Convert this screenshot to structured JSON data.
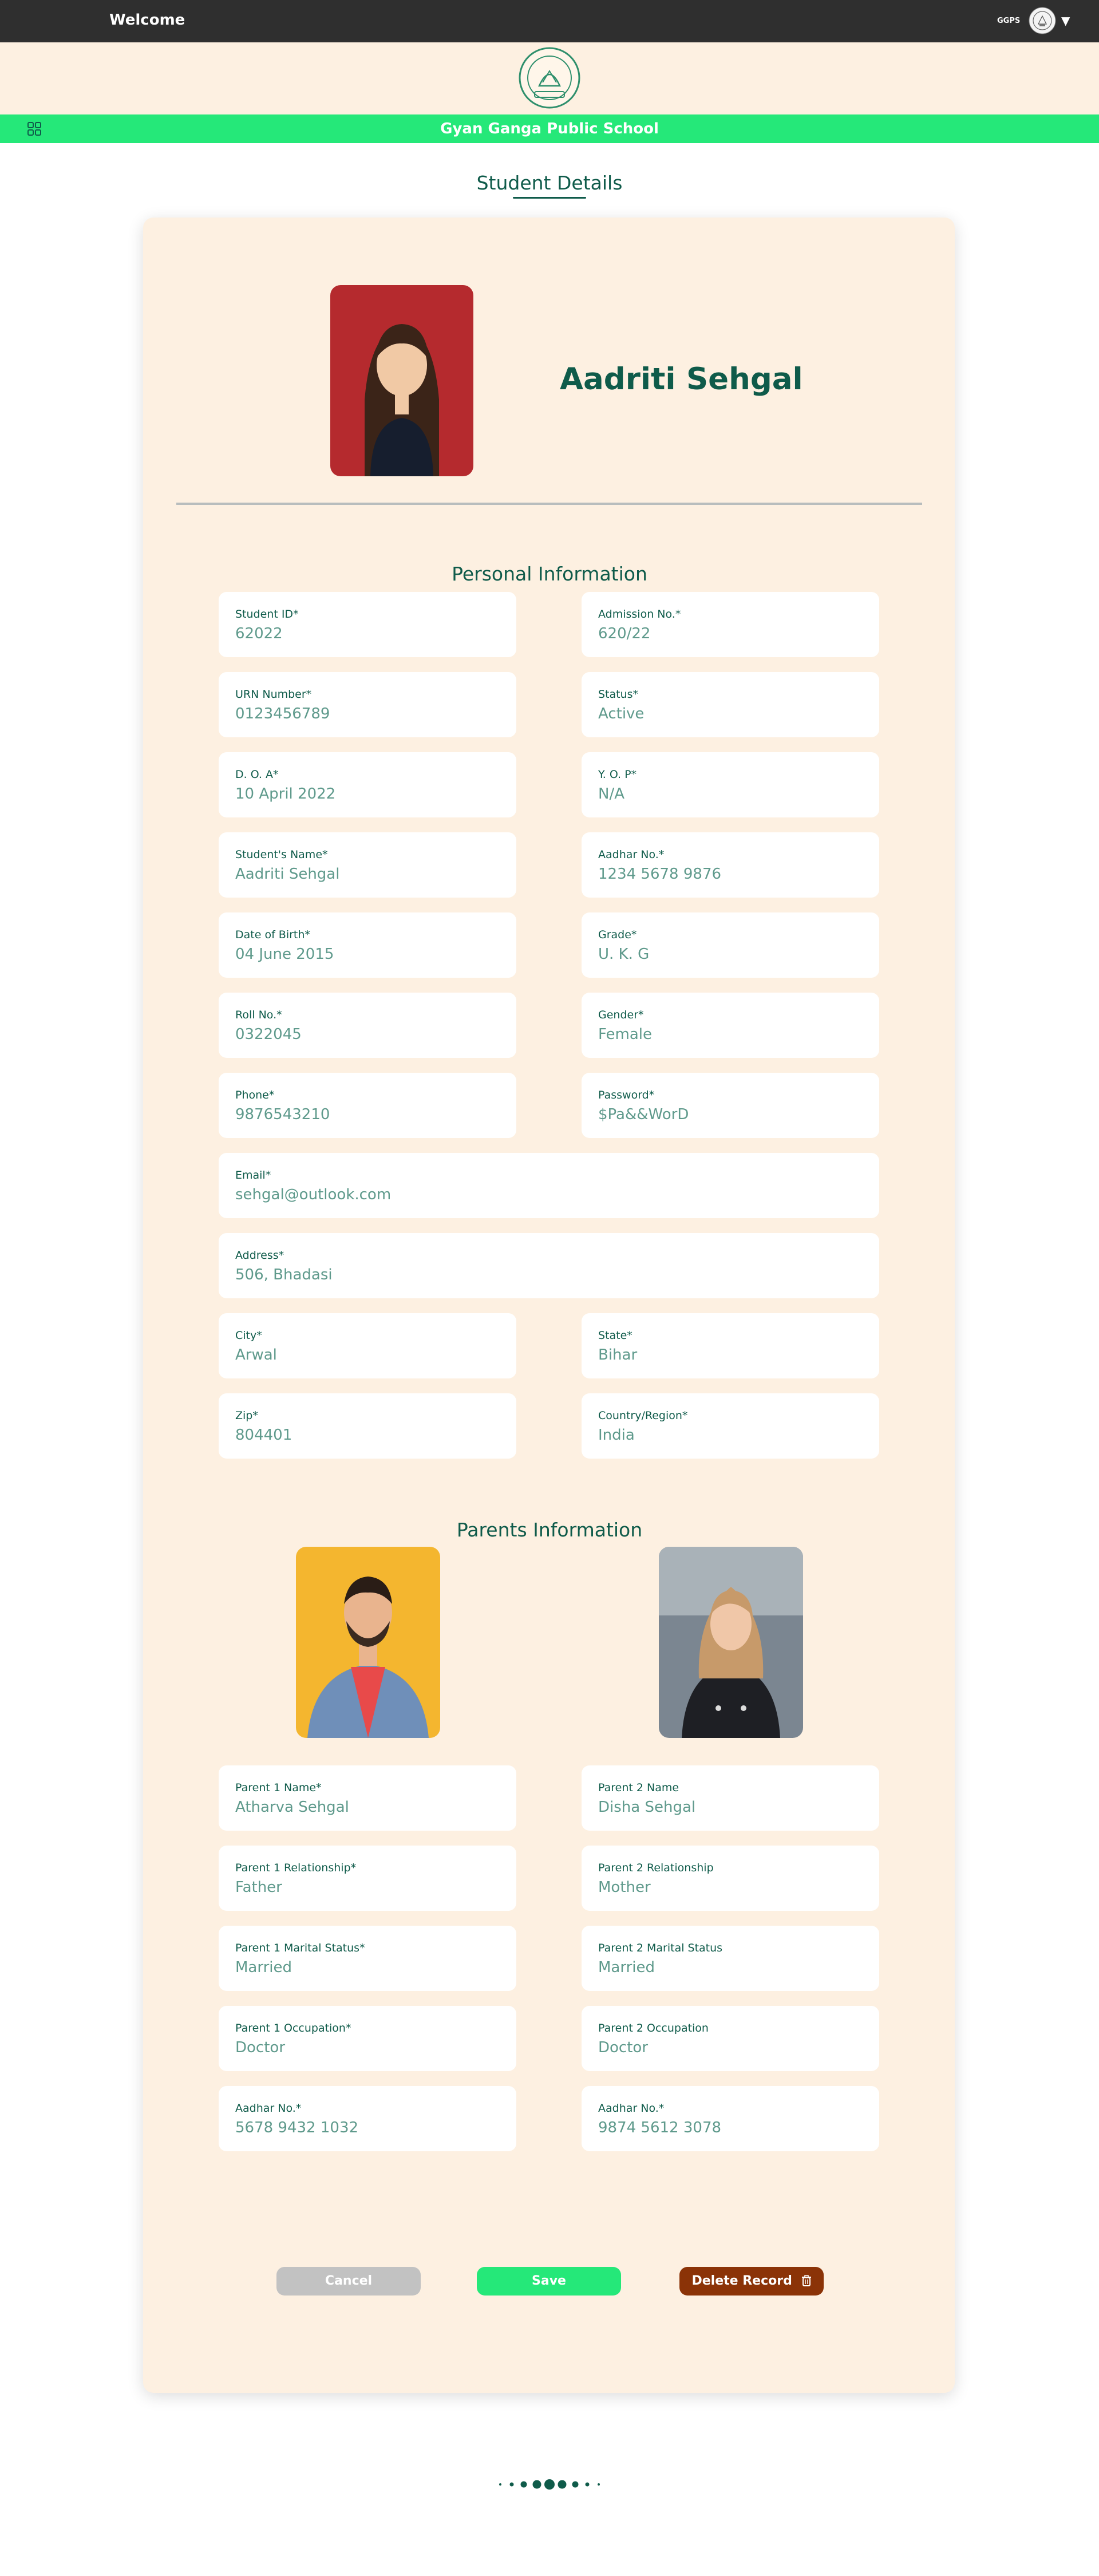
{
  "topbar": {
    "welcome": "Welcome",
    "school_short": "GGPS"
  },
  "school": {
    "name": "Gyan Ganga Public School"
  },
  "page": {
    "title": "Student Details"
  },
  "student": {
    "name": "Aadriti Sehgal"
  },
  "personal": {
    "title": "Personal Information",
    "student_id": {
      "label": "Student ID*",
      "value": "62022"
    },
    "admission_no": {
      "label": "Admission No.*",
      "value": "620/22"
    },
    "urn": {
      "label": "URN Number*",
      "value": "0123456789"
    },
    "status": {
      "label": "Status*",
      "value": "Active"
    },
    "doa": {
      "label": "D. O. A*",
      "value": "10 April 2022"
    },
    "yop": {
      "label": "Y. O. P*",
      "value": "N/A"
    },
    "student_name": {
      "label": "Student's Name*",
      "value": "Aadriti Sehgal"
    },
    "aadhar": {
      "label": "Aadhar No.*",
      "value": "1234 5678 9876"
    },
    "dob": {
      "label": "Date of Birth*",
      "value": "04 June 2015"
    },
    "grade": {
      "label": "Grade*",
      "value": "U. K. G"
    },
    "roll": {
      "label": "Roll No.*",
      "value": "0322045"
    },
    "gender": {
      "label": "Gender*",
      "value": "Female"
    },
    "phone": {
      "label": "Phone*",
      "value": "9876543210"
    },
    "password": {
      "label": "Password*",
      "value": "$Pa&&WorD"
    },
    "email": {
      "label": "Email*",
      "value": "sehgal@outlook.com"
    },
    "address": {
      "label": "Address*",
      "value": "506, Bhadasi"
    },
    "city": {
      "label": "City*",
      "value": "Arwal"
    },
    "state": {
      "label": "State*",
      "value": "Bihar"
    },
    "zip": {
      "label": "Zip*",
      "value": "804401"
    },
    "country": {
      "label": "Country/Region*",
      "value": "India"
    }
  },
  "parents": {
    "title": "Parents Information",
    "p1_name": {
      "label": "Parent 1 Name*",
      "value": "Atharva Sehgal"
    },
    "p2_name": {
      "label": "Parent 2 Name",
      "value": "Disha Sehgal"
    },
    "p1_relation": {
      "label": "Parent 1 Relationship*",
      "value": "Father"
    },
    "p2_relation": {
      "label": "Parent 2 Relationship",
      "value": "Mother"
    },
    "p1_marital": {
      "label": "Parent 1 Marital Status*",
      "value": "Married"
    },
    "p2_marital": {
      "label": "Parent 2 Marital Status",
      "value": "Married"
    },
    "p1_occupation": {
      "label": "Parent 1 Occupation*",
      "value": "Doctor"
    },
    "p2_occupation": {
      "label": "Parent 2 Occupation",
      "value": "Doctor"
    },
    "p1_aadhar": {
      "label": "Aadhar No.*",
      "value": "5678 9432 1032"
    },
    "p2_aadhar": {
      "label": "Aadhar No.*",
      "value": "9874 5612 3078"
    }
  },
  "actions": {
    "cancel": "Cancel",
    "save": "Save",
    "delete": "Delete Record"
  },
  "colors": {
    "primary": "#0f5b4a",
    "accent": "#25e879",
    "card": "#fdf0e1",
    "danger": "#8b3307",
    "value_text": "#5f9a8c"
  },
  "icons": [
    "school-logo-icon",
    "grid-menu-icon",
    "caret-down-icon",
    "trash-icon",
    "loading-dots-icon"
  ]
}
